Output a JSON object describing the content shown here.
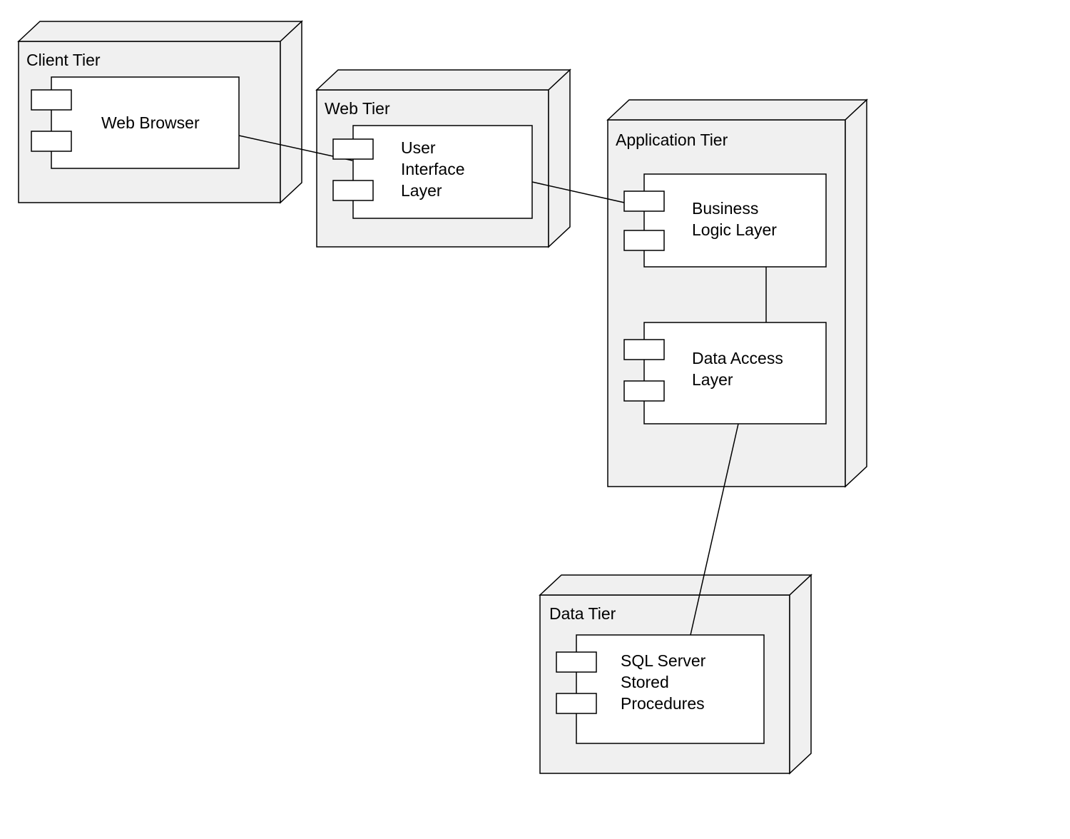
{
  "colors": {
    "nodeFill": "#f0f0f0",
    "compFill": "#ffffff",
    "stroke": "#000000"
  },
  "tiers": {
    "client": {
      "label": "Client Tier"
    },
    "web": {
      "label": "Web Tier"
    },
    "app": {
      "label": "Application Tier"
    },
    "data": {
      "label": "Data Tier"
    }
  },
  "components": {
    "webBrowser": {
      "line1": "Web Browser"
    },
    "uiLayer": {
      "line1": "User",
      "line2": "Interface",
      "line3": "Layer"
    },
    "bll": {
      "line1": "Business",
      "line2": "Logic Layer"
    },
    "dal": {
      "line1": "Data Access",
      "line2": "Layer"
    },
    "sql": {
      "line1": "SQL Server",
      "line2": "Stored",
      "line3": "Procedures"
    }
  }
}
